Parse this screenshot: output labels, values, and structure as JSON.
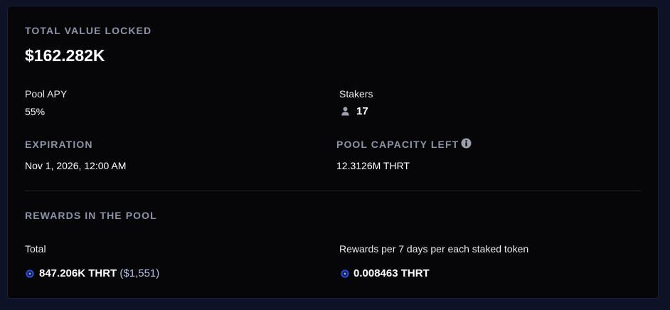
{
  "tvl": {
    "label": "TOTAL VALUE LOCKED",
    "value": "$162.282K"
  },
  "pool_apy": {
    "label": "Pool APY",
    "value": "55%"
  },
  "stakers": {
    "label": "Stakers",
    "icon": "user-icon",
    "value": "17"
  },
  "expiration": {
    "label": "EXPIRATION",
    "value": "Nov 1, 2026, 12:00 AM"
  },
  "capacity": {
    "label": "POOL CAPACITY LEFT",
    "info_icon": "info-icon",
    "value": "12.3126M THRT"
  },
  "rewards": {
    "title": "REWARDS IN THE POOL",
    "total": {
      "label": "Total",
      "token_icon": "token-icon",
      "amount": "847.206K THRT",
      "usd": "($1,551)"
    },
    "per_token": {
      "label": "Rewards per 7 days per each staked token",
      "token_icon": "token-icon",
      "amount": "0.008463 THRT"
    }
  },
  "colors": {
    "page_bg": "#0d1226",
    "card_bg": "#060608",
    "caption": "#8d94a6",
    "usd_text": "#b3bfe6",
    "token_icon": "#2a4fd6"
  }
}
